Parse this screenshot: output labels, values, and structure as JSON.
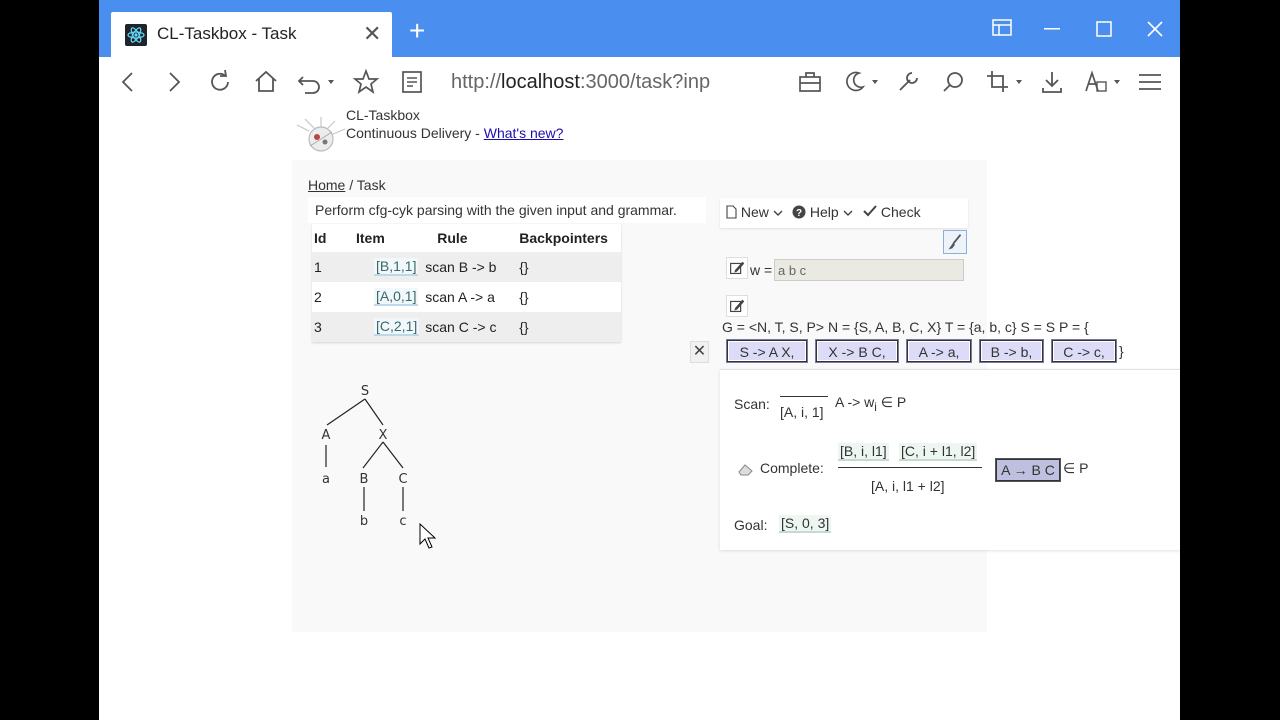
{
  "browser": {
    "tab_title": "CL-Taskbox - Task",
    "tab_close": "✕",
    "new_tab": "+",
    "url_prefix": "http://",
    "url_host": "localhost",
    "url_rest": ":3000/task?inp",
    "accent": "#4a8ff0"
  },
  "header": {
    "app_name": "CL-Taskbox",
    "subtitle": "Continuous Delivery - ",
    "whats_new": "What's new?"
  },
  "breadcrumb": {
    "home": "Home",
    "sep": " / ",
    "current": "Task"
  },
  "task": {
    "instruction": "Perform cfg-cyk parsing with the given input and grammar.",
    "columns": [
      "Id",
      "Item",
      "Rule",
      "Backpointers"
    ],
    "rows": [
      {
        "id": "1",
        "item": "[B,1,1]",
        "rule": "scan B -> b",
        "bp": "{}"
      },
      {
        "id": "2",
        "item": "[A,0,1]",
        "rule": "scan A -> a",
        "bp": "{}"
      },
      {
        "id": "3",
        "item": "[C,2,1]",
        "rule": "scan C -> c",
        "bp": "{}"
      }
    ]
  },
  "tree": {
    "root": "S",
    "level1": [
      "A",
      "X"
    ],
    "level2": [
      "a",
      "B",
      "C"
    ],
    "level3": [
      "b",
      "c"
    ]
  },
  "menu": {
    "new": "New",
    "help": "Help",
    "check": "Check"
  },
  "word": {
    "label": "w =",
    "value": "a b c"
  },
  "grammar": {
    "definition": "G = <N, T, S, P> N = {S, A, B, C, X} T = {a, b, c} S = S P = {",
    "rules": [
      "S -> A X,",
      "X -> B C,",
      "A -> a,",
      "B -> b,",
      "C -> c,"
    ],
    "close_brace": "}",
    "close_button": "✕"
  },
  "deduction": {
    "scan_label": "Scan:",
    "scan_conclusion": "[A, i, 1]",
    "scan_side_pre": "A -> w",
    "scan_side_sub": "i",
    "scan_side_post": " ∈ P",
    "complete_label": "Complete:",
    "complete_premise1": "[B, i, l1]",
    "complete_premise2": "[C, i + l1, l2]",
    "complete_conclusion": "[A, i, l1 + l2]",
    "complete_rule": "A → B C",
    "complete_side": "∈ P",
    "goal_label": "Goal:",
    "goal_item": "[S, 0, 3]"
  }
}
